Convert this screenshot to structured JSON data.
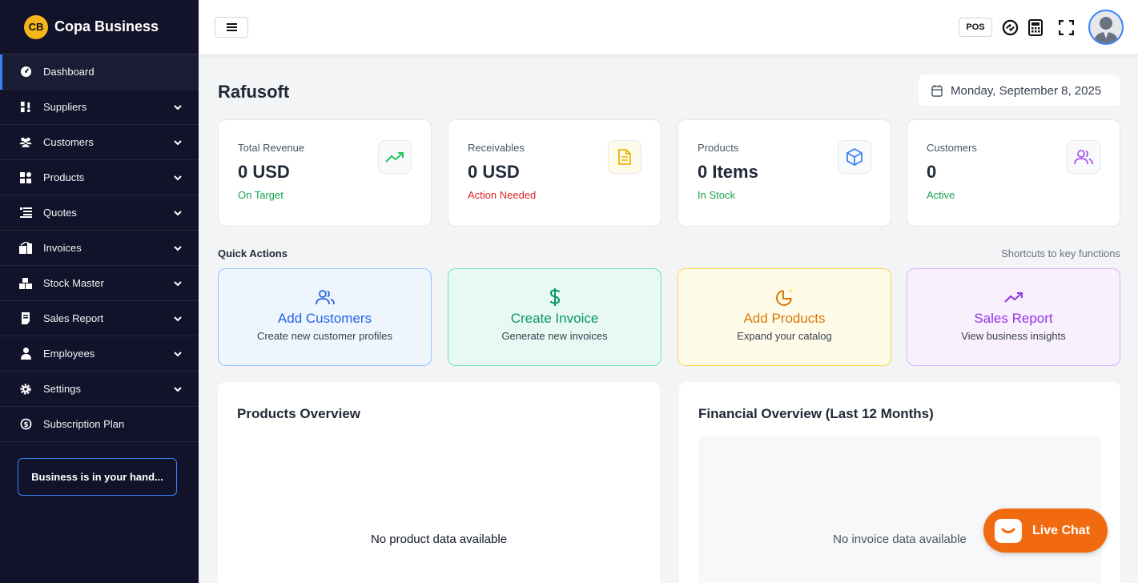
{
  "brand": {
    "name": "Copa Business",
    "logo_text": "CB"
  },
  "sidebar": {
    "items": [
      {
        "label": "Dashboard",
        "icon": "dashboard-icon",
        "active": true,
        "expandable": false
      },
      {
        "label": "Suppliers",
        "icon": "suppliers-icon",
        "expandable": true
      },
      {
        "label": "Customers",
        "icon": "users-icon",
        "expandable": true
      },
      {
        "label": "Products",
        "icon": "grid-icon",
        "expandable": true
      },
      {
        "label": "Quotes",
        "icon": "list-icon",
        "expandable": true
      },
      {
        "label": "Invoices",
        "icon": "invoice-icon",
        "expandable": true
      },
      {
        "label": "Stock Master",
        "icon": "boxes-icon",
        "expandable": true
      },
      {
        "label": "Sales Report",
        "icon": "report-icon",
        "expandable": true
      },
      {
        "label": "Employees",
        "icon": "person-icon",
        "expandable": true
      },
      {
        "label": "Settings",
        "icon": "gear-icon",
        "expandable": true
      },
      {
        "label": "Subscription Plan",
        "icon": "subscription-icon",
        "expandable": false
      }
    ],
    "promo": "Business is in your hand..."
  },
  "header": {
    "pos_label": "POS"
  },
  "main": {
    "title": "Rafusoft",
    "date": "Monday, September 8, 2025",
    "stats": [
      {
        "label": "Total Revenue",
        "value": "0 USD",
        "status": "On Target",
        "status_color": "#16a34a",
        "icon": "trend-up-icon",
        "icon_color": "#22c55e"
      },
      {
        "label": "Receivables",
        "value": "0 USD",
        "status": "Action Needed",
        "status_color": "#dc2626",
        "icon": "document-icon",
        "icon_color": "#eab308"
      },
      {
        "label": "Products",
        "value": "0 Items",
        "status": "In Stock",
        "status_color": "#16a34a",
        "icon": "cube-icon",
        "icon_color": "#3b82f6"
      },
      {
        "label": "Customers",
        "value": "0",
        "status": "Active",
        "status_color": "#16a34a",
        "icon": "users-icon",
        "icon_color": "#a855f7"
      }
    ],
    "quick_actions": {
      "title": "Quick Actions",
      "subtitle": "Shortcuts to key functions",
      "items": [
        {
          "label": "Add Customers",
          "desc": "Create new customer profiles",
          "icon": "users-icon",
          "color": "#2563eb",
          "bg": "#eef5fd",
          "border": "#93c5fd"
        },
        {
          "label": "Create Invoice",
          "desc": "Generate new invoices",
          "icon": "dollar-icon",
          "color": "#059669",
          "bg": "#e8f8f2",
          "border": "#6ee7b7"
        },
        {
          "label": "Add Products",
          "desc": "Expand your catalog",
          "icon": "pie-icon",
          "color": "#d97706",
          "bg": "#fefbe9",
          "border": "#fcd34d"
        },
        {
          "label": "Sales Report",
          "desc": "View business insights",
          "icon": "trend-up-icon",
          "color": "#9333ea",
          "bg": "#f8f0fd",
          "border": "#d8b4fe"
        }
      ]
    },
    "products_panel": {
      "title": "Products Overview",
      "empty": "No product data available"
    },
    "financial_panel": {
      "title": "Financial Overview (Last 12 Months)",
      "empty": "No invoice data available"
    }
  },
  "live_chat": {
    "label": "Live Chat"
  }
}
